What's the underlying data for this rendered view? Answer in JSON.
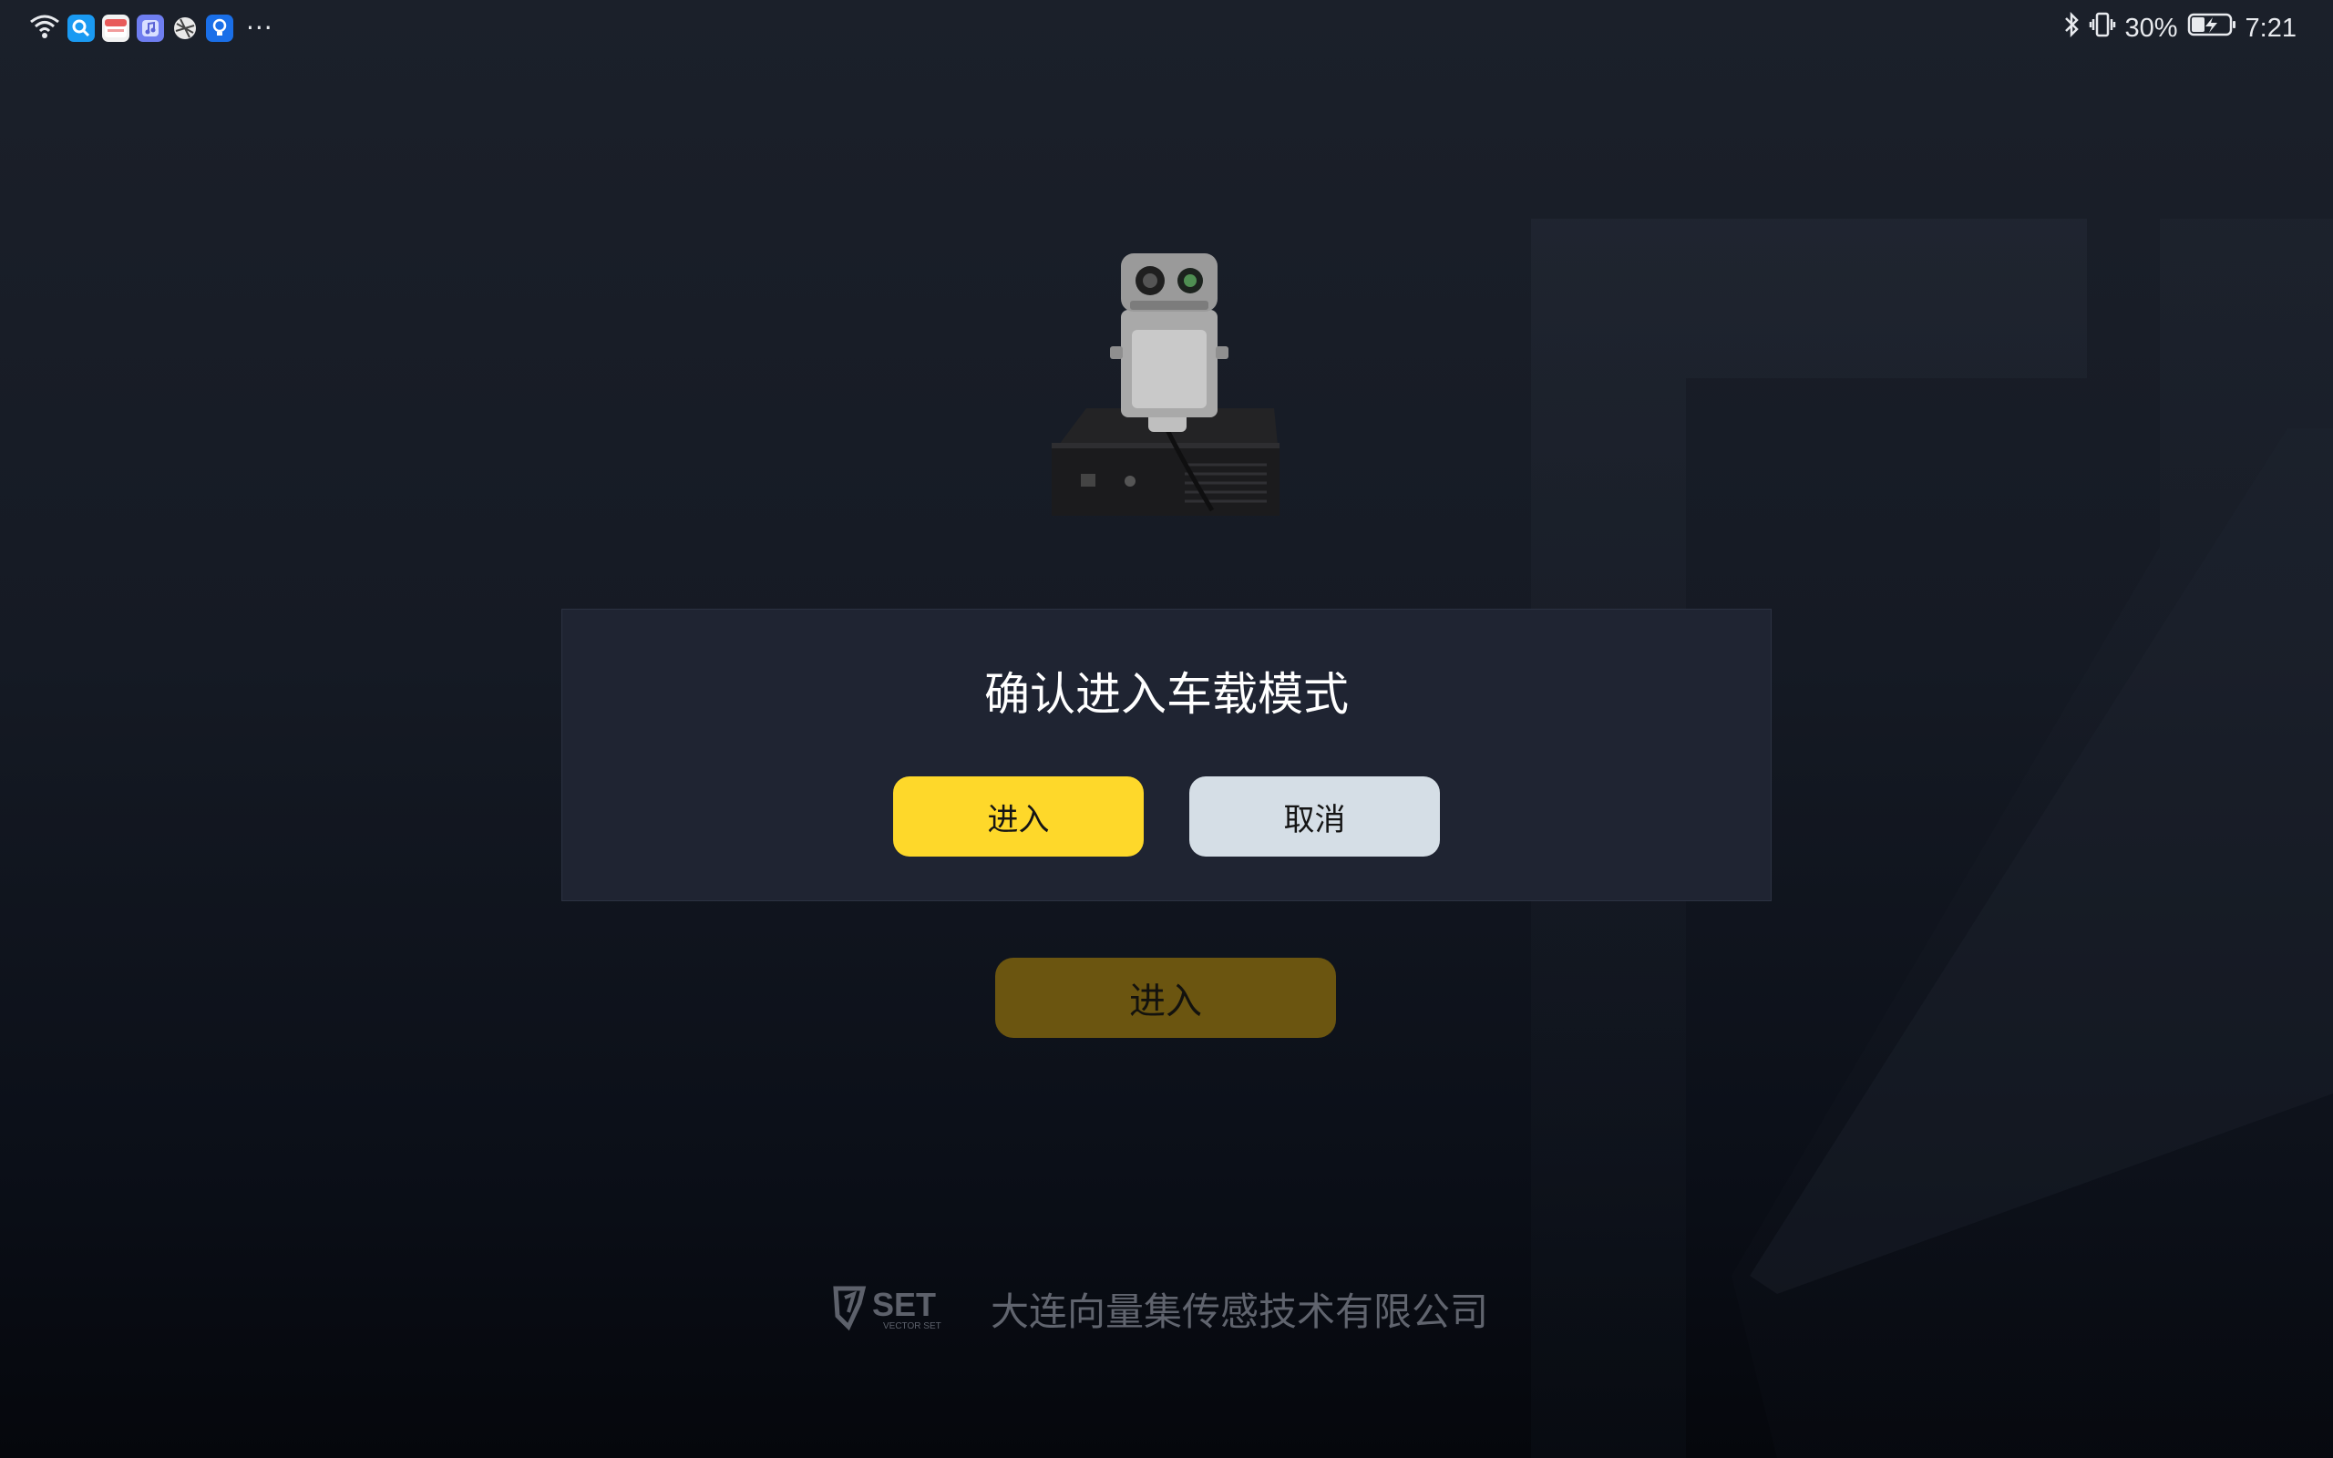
{
  "status_bar": {
    "battery_percent": "30%",
    "time": "7:21",
    "left_icons": [
      "wifi-icon",
      "search-app-icon",
      "calendar-app-icon",
      "music-app-icon",
      "browser-app-icon",
      "tips-app-icon"
    ],
    "more_indicator": "···"
  },
  "dialog": {
    "title": "确认进入车载模式",
    "confirm_label": "进入",
    "cancel_label": "取消"
  },
  "main": {
    "enter_label": "进入"
  },
  "footer": {
    "brand": "SET",
    "brand_sub": "VECTOR SET",
    "company": "大连向量集传感技术有限公司"
  },
  "colors": {
    "accent_yellow": "#fed82a",
    "cancel_gray": "#d5dee6",
    "dialog_bg": "#1f2432"
  }
}
